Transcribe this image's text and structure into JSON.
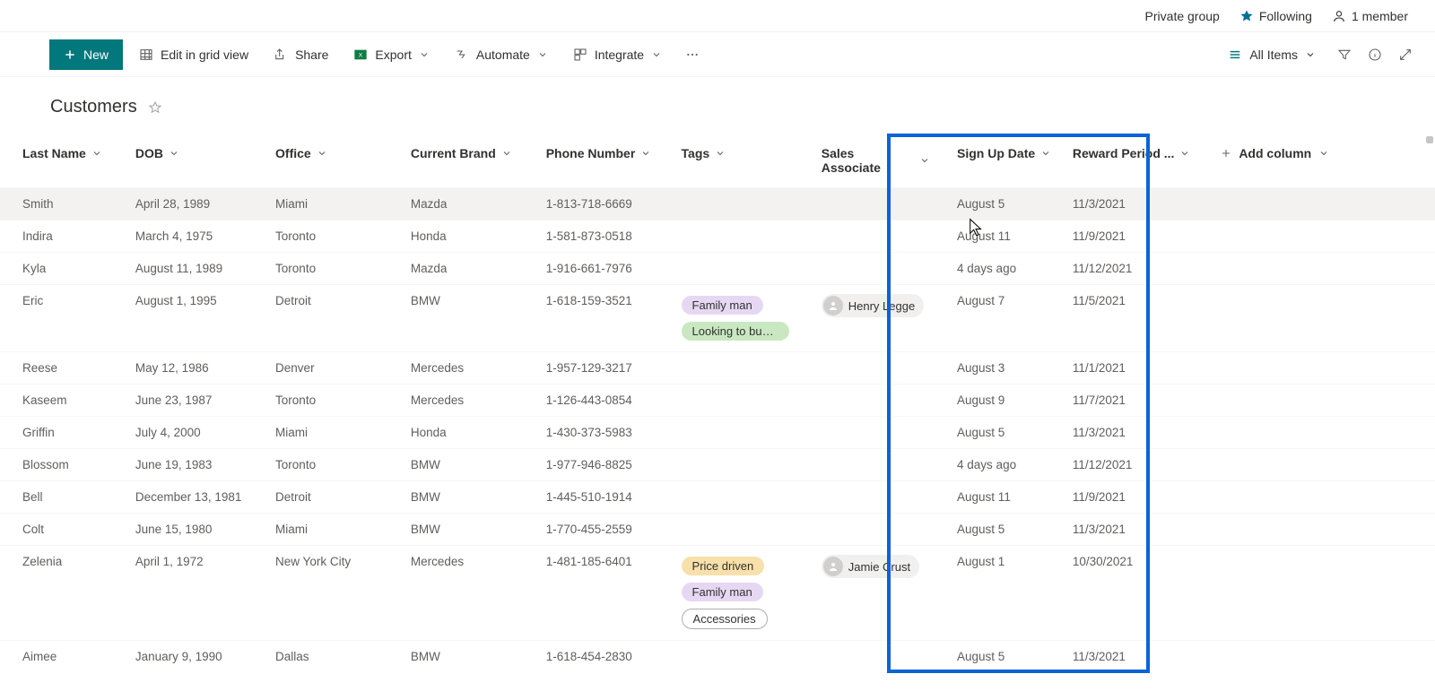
{
  "topbar": {
    "group": "Private group",
    "following": "Following",
    "members": "1 member"
  },
  "commands": {
    "new": "New",
    "edit_grid": "Edit in grid view",
    "share": "Share",
    "export": "Export",
    "automate": "Automate",
    "integrate": "Integrate",
    "all_items": "All Items"
  },
  "list": {
    "title": "Customers"
  },
  "columns": {
    "last_name": "Last Name",
    "dob": "DOB",
    "office": "Office",
    "brand": "Current Brand",
    "phone": "Phone Number",
    "tags": "Tags",
    "associate": "Sales Associate",
    "signup": "Sign Up Date",
    "reward": "Reward Period ...",
    "add": "Add column"
  },
  "tag_styles": {
    "Family man": "#e6d8f3",
    "Looking to buy s...": "#c9e8c2",
    "Price driven": "#f8e0aa",
    "Accessories": "#ffffff"
  },
  "rows": [
    {
      "ln": "Smith",
      "dob": "April 28, 1989",
      "office": "Miami",
      "brand": "Mazda",
      "phone": "1-813-718-6669",
      "tags": [],
      "assoc": "",
      "signup": "August 5",
      "reward": "11/3/2021"
    },
    {
      "ln": "Indira",
      "dob": "March 4, 1975",
      "office": "Toronto",
      "brand": "Honda",
      "phone": "1-581-873-0518",
      "tags": [],
      "assoc": "",
      "signup": "August 11",
      "reward": "11/9/2021"
    },
    {
      "ln": "Kyla",
      "dob": "August 11, 1989",
      "office": "Toronto",
      "brand": "Mazda",
      "phone": "1-916-661-7976",
      "tags": [],
      "assoc": "",
      "signup": "4 days ago",
      "reward": "11/12/2021"
    },
    {
      "ln": "Eric",
      "dob": "August 1, 1995",
      "office": "Detroit",
      "brand": "BMW",
      "phone": "1-618-159-3521",
      "tags": [
        "Family man",
        "Looking to buy s..."
      ],
      "assoc": "Henry Legge",
      "signup": "August 7",
      "reward": "11/5/2021"
    },
    {
      "ln": "Reese",
      "dob": "May 12, 1986",
      "office": "Denver",
      "brand": "Mercedes",
      "phone": "1-957-129-3217",
      "tags": [],
      "assoc": "",
      "signup": "August 3",
      "reward": "11/1/2021"
    },
    {
      "ln": "Kaseem",
      "dob": "June 23, 1987",
      "office": "Toronto",
      "brand": "Mercedes",
      "phone": "1-126-443-0854",
      "tags": [],
      "assoc": "",
      "signup": "August 9",
      "reward": "11/7/2021"
    },
    {
      "ln": "Griffin",
      "dob": "July 4, 2000",
      "office": "Miami",
      "brand": "Honda",
      "phone": "1-430-373-5983",
      "tags": [],
      "assoc": "",
      "signup": "August 5",
      "reward": "11/3/2021"
    },
    {
      "ln": "Blossom",
      "dob": "June 19, 1983",
      "office": "Toronto",
      "brand": "BMW",
      "phone": "1-977-946-8825",
      "tags": [],
      "assoc": "",
      "signup": "4 days ago",
      "reward": "11/12/2021"
    },
    {
      "ln": "Bell",
      "dob": "December 13, 1981",
      "office": "Detroit",
      "brand": "BMW",
      "phone": "1-445-510-1914",
      "tags": [],
      "assoc": "",
      "signup": "August 11",
      "reward": "11/9/2021"
    },
    {
      "ln": "Colt",
      "dob": "June 15, 1980",
      "office": "Miami",
      "brand": "BMW",
      "phone": "1-770-455-2559",
      "tags": [],
      "assoc": "",
      "signup": "August 5",
      "reward": "11/3/2021"
    },
    {
      "ln": "Zelenia",
      "dob": "April 1, 1972",
      "office": "New York City",
      "brand": "Mercedes",
      "phone": "1-481-185-6401",
      "tags": [
        "Price driven",
        "Family man",
        "Accessories"
      ],
      "assoc": "Jamie Crust",
      "signup": "August 1",
      "reward": "10/30/2021"
    },
    {
      "ln": "Aimee",
      "dob": "January 9, 1990",
      "office": "Dallas",
      "brand": "BMW",
      "phone": "1-618-454-2830",
      "tags": [],
      "assoc": "",
      "signup": "August 5",
      "reward": "11/3/2021"
    }
  ]
}
